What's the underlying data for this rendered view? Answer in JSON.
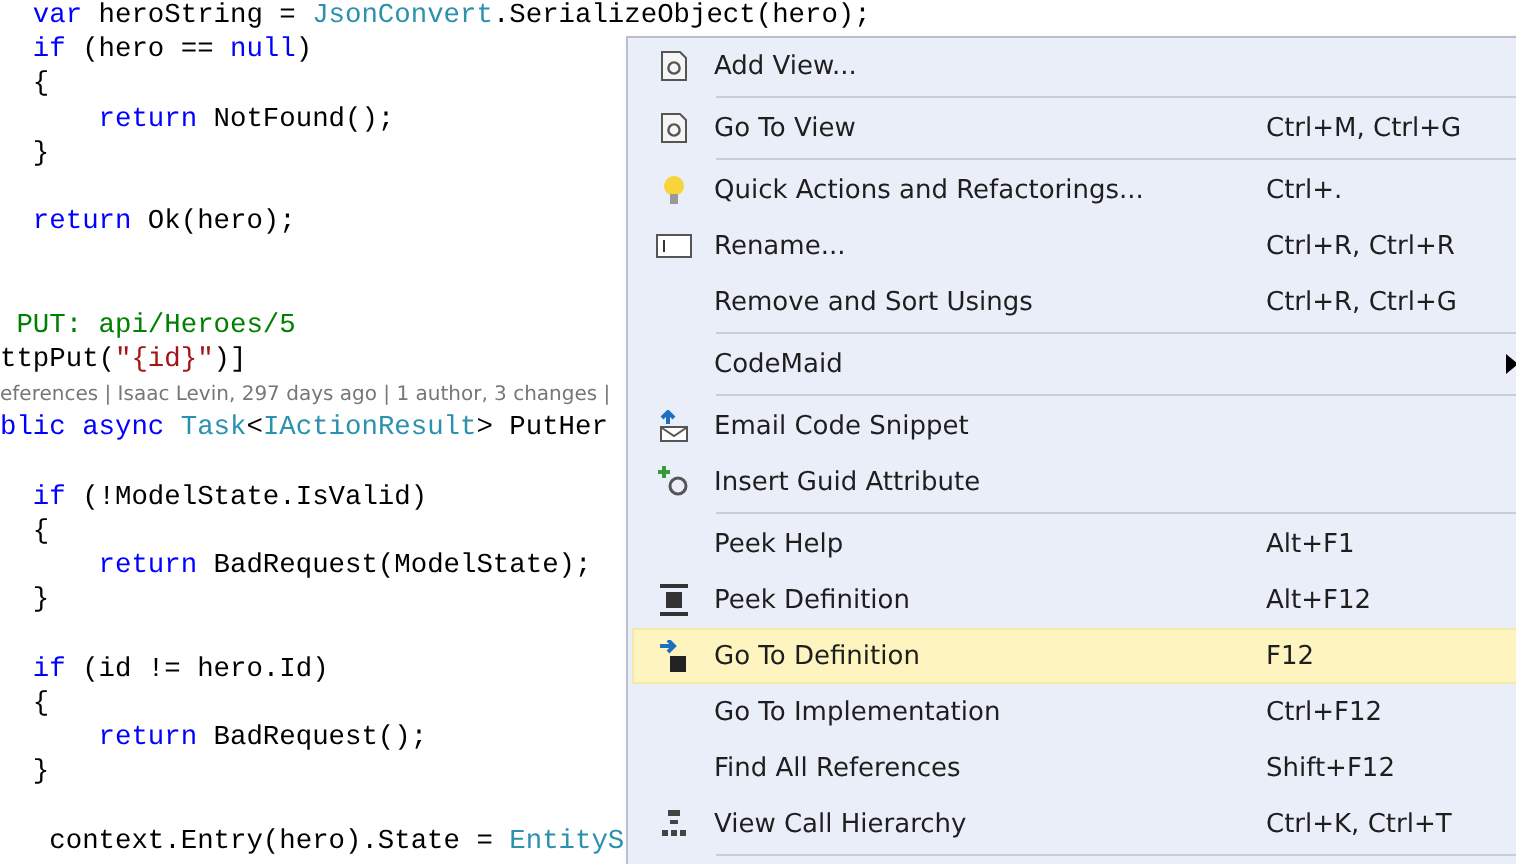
{
  "editor": {
    "lines": [
      {
        "kind": "code",
        "tokens": [
          {
            "text": "  var",
            "kind": "keyword"
          },
          {
            "text": " heroString = ",
            "kind": "plain"
          },
          {
            "text": "JsonConvert",
            "kind": "type"
          },
          {
            "text": ".SerializeObject(hero);",
            "kind": "plain"
          }
        ]
      },
      {
        "kind": "code",
        "tokens": [
          {
            "text": "  if",
            "kind": "keyword"
          },
          {
            "text": " (hero == ",
            "kind": "plain"
          },
          {
            "text": "null",
            "kind": "keyword"
          },
          {
            "text": ")",
            "kind": "plain"
          }
        ]
      },
      {
        "kind": "code",
        "tokens": [
          {
            "text": "  {",
            "kind": "plain"
          }
        ]
      },
      {
        "kind": "code",
        "tokens": [
          {
            "text": "      return",
            "kind": "keyword"
          },
          {
            "text": " NotFound();",
            "kind": "plain"
          }
        ]
      },
      {
        "kind": "code",
        "tokens": [
          {
            "text": "  }",
            "kind": "plain"
          }
        ]
      },
      {
        "kind": "blank"
      },
      {
        "kind": "code",
        "tokens": [
          {
            "text": "  return",
            "kind": "keyword"
          },
          {
            "text": " Ok(hero);",
            "kind": "plain"
          }
        ]
      },
      {
        "kind": "blank"
      },
      {
        "kind": "blank"
      },
      {
        "kind": "code",
        "tokens": [
          {
            "text": " PUT: api/Heroes/5",
            "kind": "comment"
          }
        ]
      },
      {
        "kind": "code",
        "tokens": [
          {
            "text": "ttpPut(",
            "kind": "plain"
          },
          {
            "text": "\"{id}\"",
            "kind": "string"
          },
          {
            "text": ")]",
            "kind": "plain"
          }
        ]
      },
      {
        "kind": "lens",
        "text": "eferences | Isaac Levin, 297 days ago | 1 author, 3 changes |"
      },
      {
        "kind": "code",
        "tokens": [
          {
            "text": "blic ",
            "kind": "keyword"
          },
          {
            "text": "async",
            "kind": "keyword"
          },
          {
            "text": " Task",
            "kind": "type"
          },
          {
            "text": "<",
            "kind": "plain"
          },
          {
            "text": "IActionResult",
            "kind": "type"
          },
          {
            "text": "> PutHer",
            "kind": "plain"
          }
        ]
      },
      {
        "kind": "blank"
      },
      {
        "kind": "code",
        "tokens": [
          {
            "text": "  if",
            "kind": "keyword"
          },
          {
            "text": " (!ModelState.IsValid)",
            "kind": "plain"
          }
        ]
      },
      {
        "kind": "code",
        "tokens": [
          {
            "text": "  {",
            "kind": "plain"
          }
        ]
      },
      {
        "kind": "code",
        "tokens": [
          {
            "text": "      return",
            "kind": "keyword"
          },
          {
            "text": " BadRequest(ModelState);",
            "kind": "plain"
          }
        ]
      },
      {
        "kind": "code",
        "tokens": [
          {
            "text": "  }",
            "kind": "plain"
          }
        ]
      },
      {
        "kind": "blank"
      },
      {
        "kind": "code",
        "tokens": [
          {
            "text": "  if",
            "kind": "keyword"
          },
          {
            "text": " (id != hero.Id)",
            "kind": "plain"
          }
        ]
      },
      {
        "kind": "code",
        "tokens": [
          {
            "text": "  {",
            "kind": "plain"
          }
        ]
      },
      {
        "kind": "code",
        "tokens": [
          {
            "text": "      return",
            "kind": "keyword"
          },
          {
            "text": " BadRequest();",
            "kind": "plain"
          }
        ]
      },
      {
        "kind": "code",
        "tokens": [
          {
            "text": "  }",
            "kind": "plain"
          }
        ]
      },
      {
        "kind": "blank"
      },
      {
        "kind": "code",
        "tokens": [
          {
            "text": "   context.Entry(hero).State = ",
            "kind": "plain"
          },
          {
            "text": "EntityS",
            "kind": "type"
          }
        ]
      }
    ]
  },
  "context_menu": {
    "items": [
      {
        "kind": "item",
        "label": "Add View...",
        "selected": false
      },
      {
        "kind": "separator"
      },
      {
        "kind": "item",
        "label": "Go To View",
        "shortcut": "Ctrl+M, Ctrl+G",
        "selected": false
      },
      {
        "kind": "separator"
      },
      {
        "kind": "item",
        "label": "Quick Actions and Refactorings...",
        "shortcut": "Ctrl+.",
        "selected": false
      },
      {
        "kind": "item",
        "label": "Rename...",
        "shortcut": "Ctrl+R, Ctrl+R",
        "selected": false
      },
      {
        "kind": "item",
        "label": "Remove and Sort Usings",
        "shortcut": "Ctrl+R, Ctrl+G",
        "selected": false
      },
      {
        "kind": "separator"
      },
      {
        "kind": "item",
        "label": "CodeMaid",
        "submenu": true,
        "selected": false
      },
      {
        "kind": "separator"
      },
      {
        "kind": "item",
        "label": "Email Code Snippet",
        "selected": false
      },
      {
        "kind": "item",
        "label": "Insert Guid Attribute",
        "selected": false
      },
      {
        "kind": "separator"
      },
      {
        "kind": "item",
        "label": "Peek Help",
        "shortcut": "Alt+F1",
        "selected": false
      },
      {
        "kind": "item",
        "label": "Peek Definition",
        "shortcut": "Alt+F12",
        "selected": false
      },
      {
        "kind": "item",
        "label": "Go To Definition",
        "shortcut": "F12",
        "selected": true
      },
      {
        "kind": "item",
        "label": "Go To Implementation",
        "shortcut": "Ctrl+F12",
        "selected": false
      },
      {
        "kind": "item",
        "label": "Find All References",
        "shortcut": "Shift+F12",
        "selected": false
      },
      {
        "kind": "item",
        "label": "View Call Hierarchy",
        "shortcut": "Ctrl+K, Ctrl+T",
        "selected": false
      },
      {
        "kind": "separator"
      }
    ]
  }
}
